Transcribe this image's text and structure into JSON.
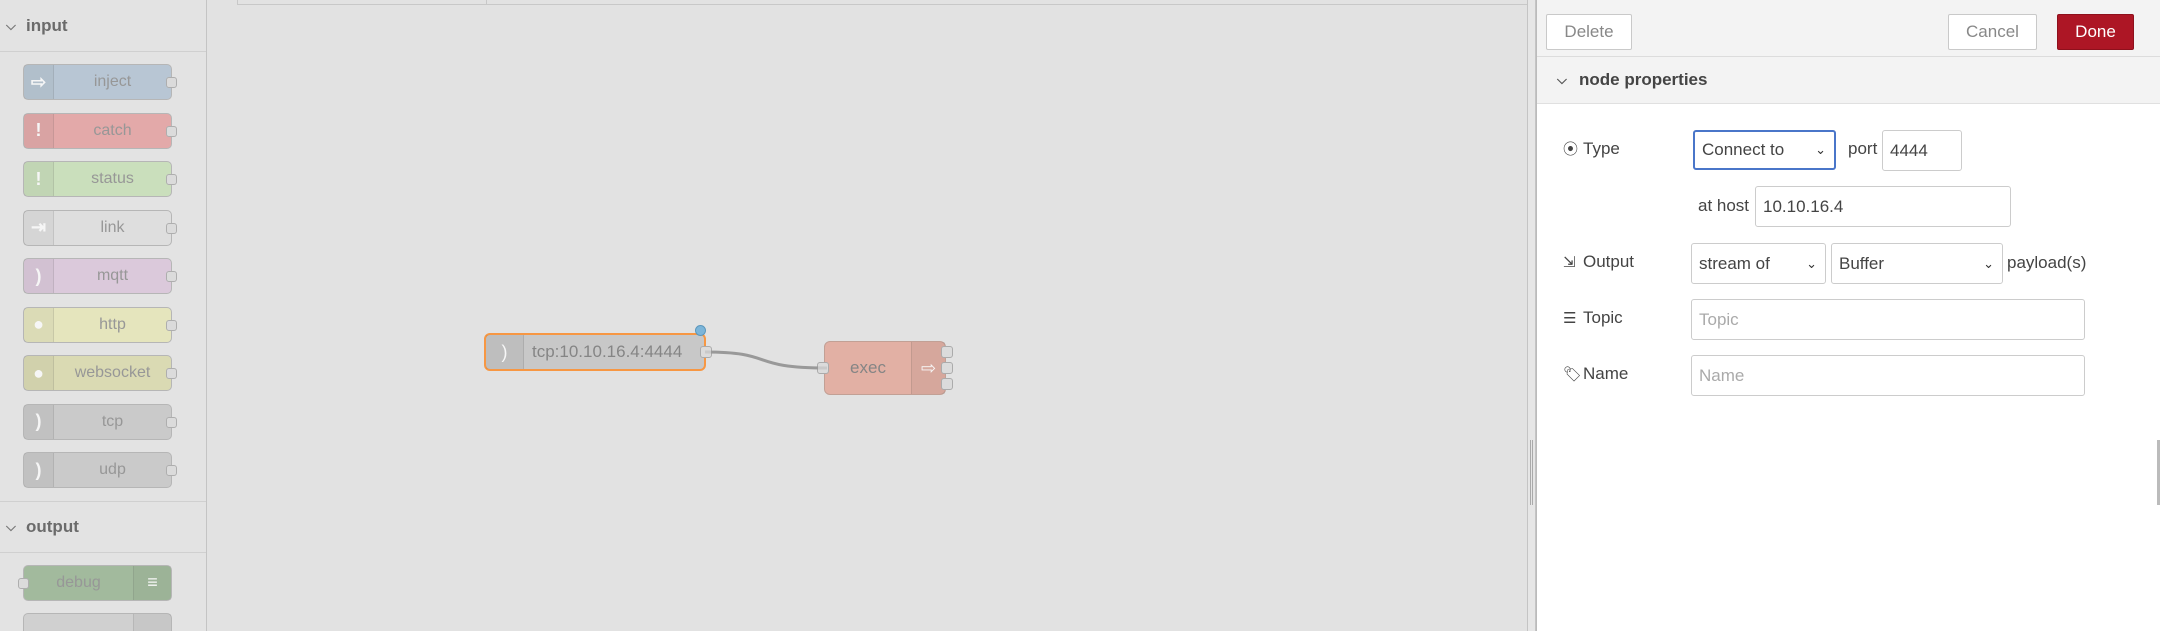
{
  "palette": {
    "categories": [
      {
        "label": "input",
        "nodes": [
          {
            "label": "inject",
            "color": "#a6bbcf",
            "icon": "arrow-right-icon"
          },
          {
            "label": "catch",
            "color": "#e49191",
            "icon": "exclamation-icon"
          },
          {
            "label": "status",
            "color": "#c0deac",
            "icon": "exclamation-icon"
          },
          {
            "label": "link",
            "color": "#dddddd",
            "icon": "link-in-icon"
          },
          {
            "label": "mqtt",
            "color": "#d8bfd8",
            "icon": "wifi-icon"
          },
          {
            "label": "http",
            "color": "#e7e7ae",
            "icon": "globe-icon"
          },
          {
            "label": "websocket",
            "color": "#d7d7a0",
            "icon": "globe-icon"
          },
          {
            "label": "tcp",
            "color": "#c0c0c0",
            "icon": "wifi-icon"
          },
          {
            "label": "udp",
            "color": "#c0c0c0",
            "icon": "wifi-icon"
          }
        ]
      },
      {
        "label": "output",
        "nodes": [
          {
            "label": "debug",
            "color": "#87a980",
            "icon": "list-icon"
          }
        ]
      }
    ]
  },
  "workspace": {
    "nodes": [
      {
        "label": "tcp:10.10.16.4:4444",
        "color": "#c0c0c0",
        "selected": true
      },
      {
        "label": "exec",
        "color": "#e2a090"
      }
    ]
  },
  "tray": {
    "toolbar": {
      "delete_label": "Delete",
      "cancel_label": "Cancel",
      "done_label": "Done"
    },
    "section_title": "node properties",
    "form": {
      "type_label": "Type",
      "type_value": "Connect to",
      "port_label": "port",
      "port_value": "4444",
      "host_label": "at host",
      "host_value": "10.10.16.4",
      "output_label": "Output",
      "output_mode": "stream of",
      "output_format": "Buffer",
      "output_suffix": "payload(s)",
      "topic_label": "Topic",
      "topic_placeholder": "Topic",
      "name_label": "Name",
      "name_placeholder": "Name"
    }
  }
}
